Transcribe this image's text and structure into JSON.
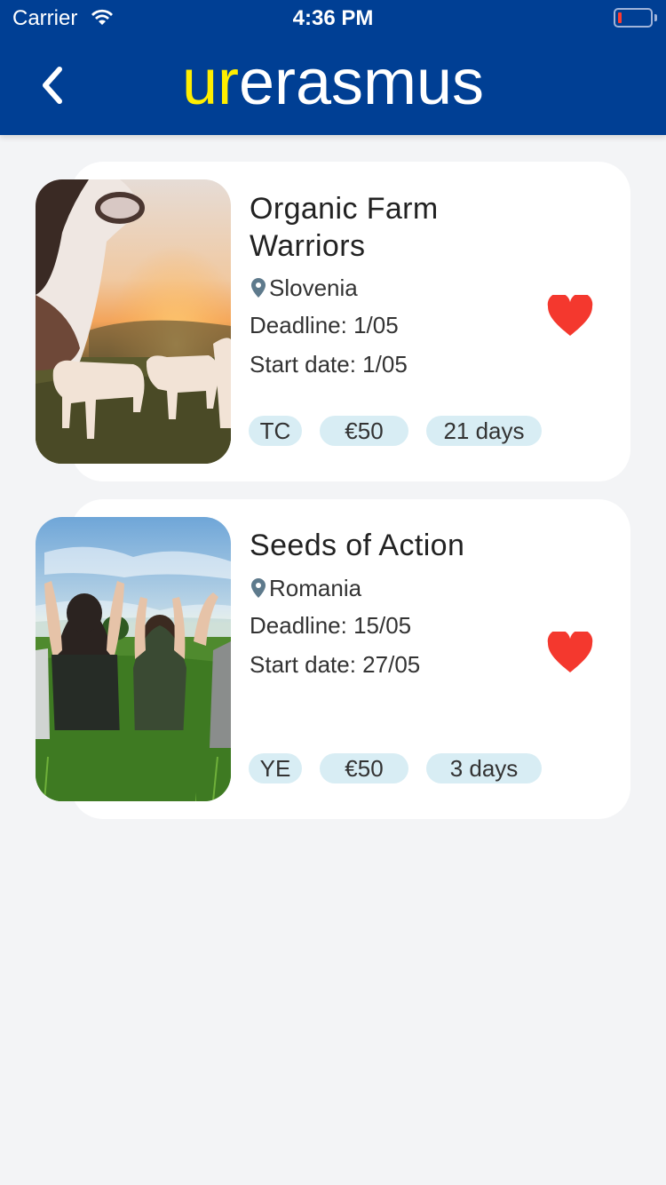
{
  "status_bar": {
    "carrier": "Carrier",
    "time": "4:36 PM"
  },
  "header": {
    "brand_prefix": "ur",
    "brand_suffix": "erasmus"
  },
  "colors": {
    "header_bg": "#003f94",
    "brand_accent": "#ffee00",
    "favorite": "#f4382e",
    "chip_bg": "#d8edf4"
  },
  "projects": [
    {
      "title_line1": "Organic Farm",
      "title_line2": "Warriors",
      "location": "Slovenia",
      "deadline": "Deadline: 1/05",
      "start_date": "Start date: 1/05",
      "tags": [
        "TC",
        "€50",
        "21 days"
      ],
      "favorite": true,
      "image": "cows-at-sunset-photo"
    },
    {
      "title_line1": "Seeds of Action",
      "title_line2": "",
      "location": "Romania",
      "deadline": "Deadline: 15/05",
      "start_date": "Start date: 27/05",
      "tags": [
        "YE",
        "€50",
        "3 days"
      ],
      "favorite": true,
      "image": "group-making-hearts-photo"
    }
  ]
}
